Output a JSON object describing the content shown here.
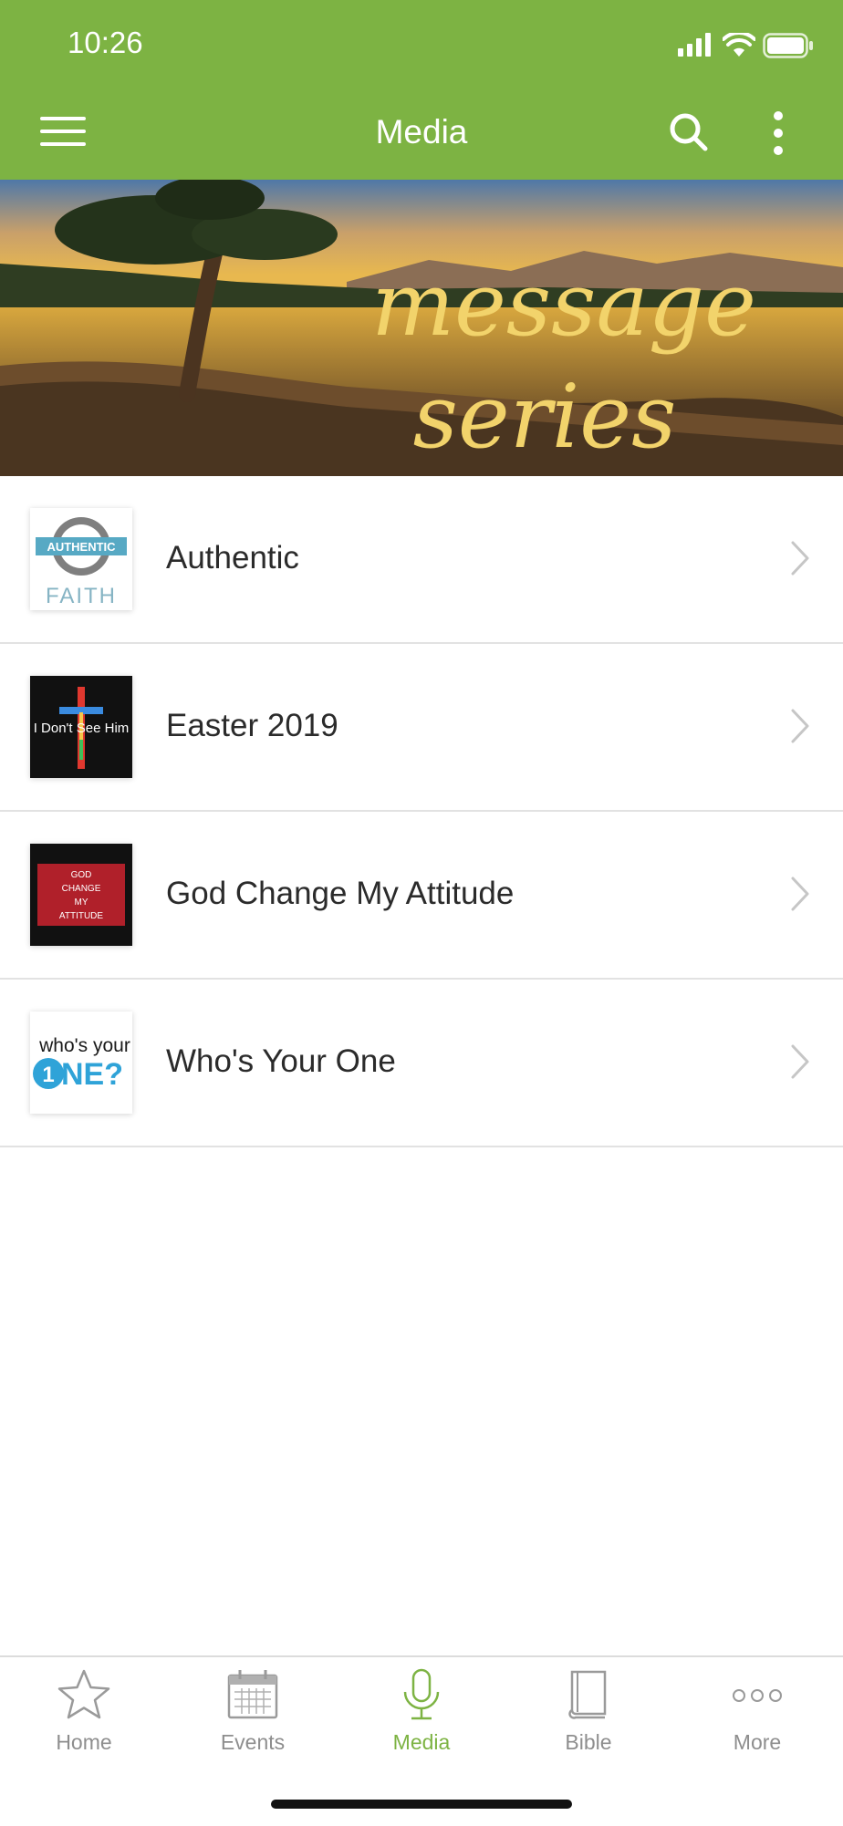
{
  "status_bar": {
    "time": "10:26"
  },
  "header": {
    "title": "Media"
  },
  "banner": {
    "line1": "message",
    "line2": "series"
  },
  "series": [
    {
      "label": "Authentic",
      "thumb_text": [
        "AUTHENTIC",
        "FAITH"
      ]
    },
    {
      "label": "Easter 2019",
      "thumb_text": [
        "I Don't See Him"
      ]
    },
    {
      "label": "God Change My Attitude",
      "thumb_text": [
        "GOD",
        "CHANGE",
        "MY",
        "ATTITUDE"
      ]
    },
    {
      "label": "Who's Your One",
      "thumb_text": [
        "who's your",
        "NE?"
      ]
    }
  ],
  "tabs": [
    {
      "label": "Home",
      "icon": "star-icon"
    },
    {
      "label": "Events",
      "icon": "calendar-icon"
    },
    {
      "label": "Media",
      "icon": "microphone-icon",
      "active": true
    },
    {
      "label": "Bible",
      "icon": "book-icon"
    },
    {
      "label": "More",
      "icon": "more-dots-icon"
    }
  ],
  "colors": {
    "accent": "#7db343",
    "banner_text": "#f2d36b"
  }
}
